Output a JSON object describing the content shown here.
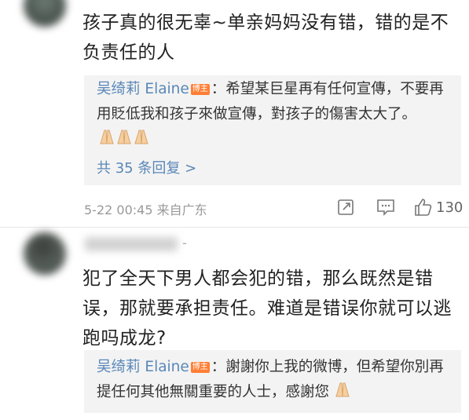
{
  "comments": [
    {
      "text": "孩子真的很无辜~单亲妈妈没有错，错的是不负责任的人",
      "reply": {
        "author": "吴绮莉 Elaine",
        "badge": "博主",
        "text": "：希望某巨星再有任何宣傳，不要再用貶低我和孩子來做宣傳，對孩子的傷害太大了。",
        "emoji": "pray-emoji x3"
      },
      "more_replies": "共 35 条回复 >",
      "timestamp": "5-22 00:45",
      "location": "来自广东",
      "like_count": "130"
    },
    {
      "name_suffix": "-",
      "text": "犯了全天下男人都会犯的错，那么既然是错误，那就要承担责任。难道是错误你就可以逃跑吗成龙?",
      "reply": {
        "author": "吴绮莉 Elaine",
        "badge": "博主",
        "text": "：謝謝你上我的微博，但希望你別再提任何其他無關重要的人士，感謝您",
        "emoji": "pray-emoji x1"
      }
    }
  ],
  "colors": {
    "link": "#5a87b8",
    "badge": "#ff7f35",
    "reply_bg": "#f3f3f3",
    "meta": "#999999"
  }
}
